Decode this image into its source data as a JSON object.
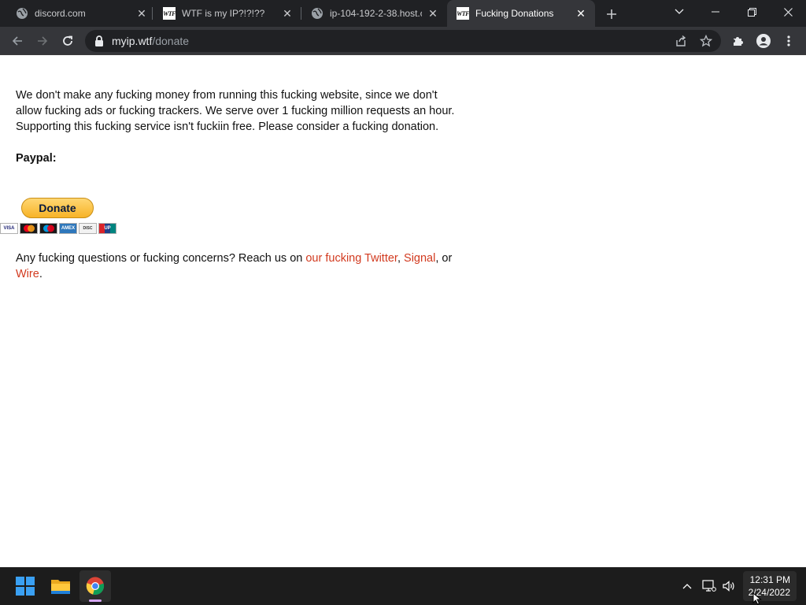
{
  "browser": {
    "tabs": [
      {
        "title": "discord.com",
        "favicon": "globe-icon"
      },
      {
        "title": "WTF is my IP?!?!??",
        "favicon": "wtf-favicon"
      },
      {
        "title": "ip-104-192-2-38.host.c",
        "favicon": "globe-icon"
      },
      {
        "title": "Fucking Donations",
        "favicon": "wtf-favicon",
        "active": true
      }
    ],
    "favicon_text": "WTF",
    "address": {
      "domain": "myip.wtf",
      "path": "/donate"
    }
  },
  "page": {
    "intro": "We don't make any fucking money from running this fucking website, since we don't allow fucking ads or fucking trackers. We serve over 1 fucking million requests an hour. Supporting this fucking service isn't fuckiin free. Please consider a fucking donation.",
    "paypal_label": "Paypal:",
    "donate_button": "Donate",
    "cards": [
      "VISA",
      "MC",
      "MAE",
      "AMEX",
      "DISC",
      "UP"
    ],
    "questions": {
      "prefix": "Any fucking questions or fucking concerns? Reach us on ",
      "link_twitter": "our fucking Twitter",
      "sep1": ", ",
      "link_signal": "Signal",
      "sep2": ", or ",
      "link_wire": "Wire",
      "suffix": "."
    }
  },
  "taskbar": {
    "apps": [
      "windows-start-icon",
      "file-explorer-icon",
      "chrome-icon"
    ],
    "time": "12:31 PM",
    "date": "2/24/2022"
  },
  "colors": {
    "link": "#d23a1f",
    "tab_bg": "#202124",
    "toolbar_bg": "#35363a"
  }
}
